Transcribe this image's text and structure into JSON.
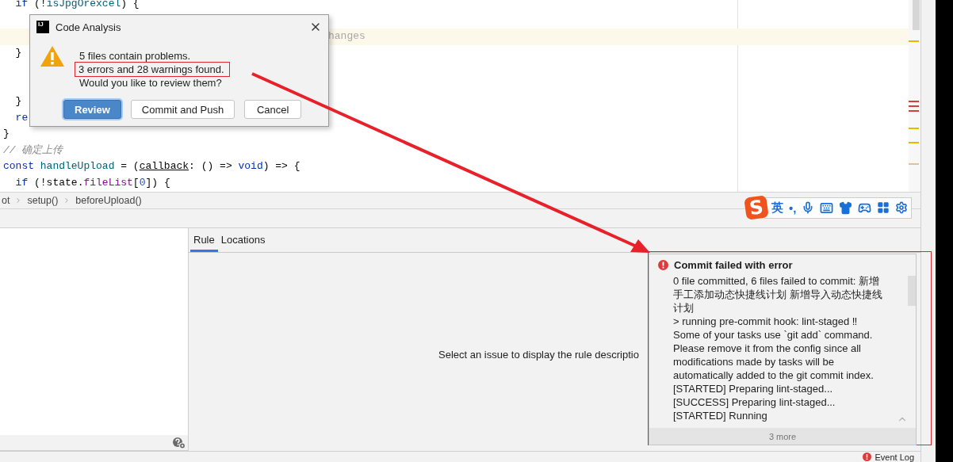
{
  "editor": {
    "lines": [
      {
        "kind": "code",
        "highlighted": false,
        "tokens": [
          {
            "kind": "keyword",
            "text": "  if"
          },
          {
            "kind": "plain",
            "text": " (!"
          },
          {
            "kind": "function",
            "text": "isJpgOrexcel"
          },
          {
            "kind": "plain",
            "text": ") {"
          }
        ]
      },
      {
        "kind": "blank",
        "highlighted": false
      },
      {
        "kind": "code",
        "highlighted": true,
        "tokens": [
          {
            "kind": "faded",
            "text": "hanges"
          }
        ]
      },
      {
        "kind": "code",
        "highlighted": false,
        "tokens": [
          {
            "kind": "plain",
            "text": "  }"
          }
        ]
      },
      {
        "kind": "blank",
        "highlighted": false
      },
      {
        "kind": "blank",
        "highlighted": false
      },
      {
        "kind": "code",
        "highlighted": false,
        "tokens": [
          {
            "kind": "plain",
            "text": "  }"
          }
        ]
      },
      {
        "kind": "code",
        "highlighted": false,
        "tokens": [
          {
            "kind": "keyword",
            "text": "  re"
          }
        ]
      },
      {
        "kind": "code",
        "highlighted": false,
        "tokens": [
          {
            "kind": "plain",
            "text": "}"
          }
        ]
      },
      {
        "kind": "code",
        "highlighted": false,
        "tokens": [
          {
            "kind": "comment",
            "text": "// 确定上传"
          }
        ]
      },
      {
        "kind": "code",
        "highlighted": false,
        "tokens": [
          {
            "kind": "keyword",
            "text": "const"
          },
          {
            "kind": "function",
            "text": " handleUpload"
          },
          {
            "kind": "plain",
            "text": " = ("
          },
          {
            "kind": "param",
            "text": "callback"
          },
          {
            "kind": "plain",
            "text": ": () => "
          },
          {
            "kind": "keyword",
            "text": "void"
          },
          {
            "kind": "plain",
            "text": ") => {"
          }
        ]
      },
      {
        "kind": "code",
        "highlighted": false,
        "tokens": [
          {
            "kind": "keyword",
            "text": "  if"
          },
          {
            "kind": "plain",
            "text": " (!state."
          },
          {
            "kind": "field",
            "text": "fileList"
          },
          {
            "kind": "plain",
            "text": "["
          },
          {
            "kind": "number",
            "text": "0"
          },
          {
            "kind": "plain",
            "text": "]) {"
          }
        ]
      }
    ]
  },
  "dialog": {
    "logo": "IJ",
    "title": "Code Analysis",
    "messages": [
      {
        "text": "5 files contain problems.",
        "highlighted": false
      },
      {
        "text": "3 errors and 28 warnings found.",
        "highlighted": true
      },
      {
        "text": "Would you like to review them?",
        "highlighted": false
      }
    ],
    "buttons": [
      {
        "label": "Review",
        "default": true
      },
      {
        "label": "Commit and Push",
        "default": false
      },
      {
        "label": "Cancel",
        "default": false
      }
    ]
  },
  "breadcrumbs": [
    "ot",
    "setup()",
    "beforeUpload()"
  ],
  "ime_toolbar": {
    "logo": "S",
    "labels": [
      "英",
      "•,"
    ]
  },
  "problems_panel": {
    "tabs": [
      {
        "label": "Rule",
        "selected": true
      },
      {
        "label": "Locations",
        "selected": false
      }
    ],
    "empty_text": "Select an issue to display the rule descriptio"
  },
  "notification": {
    "title": "Commit failed with error",
    "body": "0 file committed, 6 files failed to commit: 新增手工添加动态快捷线计划 新增导入动态快捷线计划\n> running pre-commit hook: lint-staged ‼ Some of your tasks use `git add` command. Please remove it from the config since all modifications made by tasks will be automatically added to the git commit index. [STARTED] Preparing lint-staged... [SUCCESS] Preparing lint-staged... [STARTED] Running",
    "footer": "3 more"
  },
  "status_bar": {
    "event_log": "Event Log"
  }
}
